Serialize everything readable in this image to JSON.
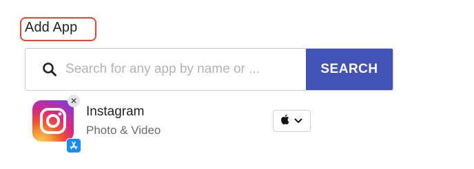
{
  "title": "Add App",
  "colors": {
    "title_outline": "#e8442e",
    "search_button_bg": "#4352b5",
    "store_badge": "#1b8cf5"
  },
  "search": {
    "placeholder": "Search for any app by name or ...",
    "value": "",
    "button_label": "SEARCH",
    "icon": "search-icon"
  },
  "app": {
    "name": "Instagram",
    "category": "Photo & Video",
    "icon": "instagram-icon",
    "store_badge_icon": "app-store-icon",
    "remove_icon": "close-icon",
    "platform": {
      "icon": "apple-icon",
      "dropdown_icon": "chevron-down-icon"
    }
  }
}
